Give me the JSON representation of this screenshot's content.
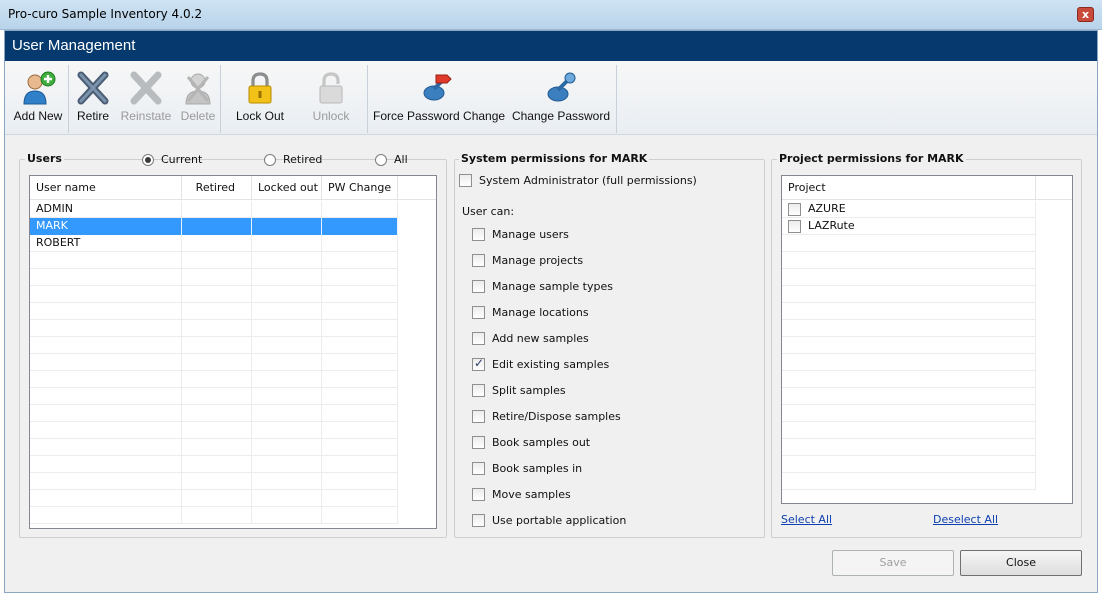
{
  "window": {
    "title": "Pro-curo Sample Inventory 4.0.2",
    "close_glyph": "x"
  },
  "header": {
    "title": "User Management"
  },
  "toolbar": {
    "add_new": "Add New",
    "retire": "Retire",
    "reinstate": "Reinstate",
    "delete": "Delete",
    "lock_out": "Lock Out",
    "unlock": "Unlock",
    "force_password_change": "Force Password Change",
    "change_password": "Change Password"
  },
  "users_panel": {
    "title": "Users",
    "filters": {
      "current": "Current",
      "retired": "Retired",
      "all": "All",
      "selected": "current"
    },
    "columns": [
      "User name",
      "Retired",
      "Locked out",
      "PW Change"
    ],
    "rows": [
      {
        "name": "ADMIN",
        "retired": "",
        "locked_out": "",
        "pw_change": ""
      },
      {
        "name": "MARK",
        "retired": "",
        "locked_out": "",
        "pw_change": ""
      },
      {
        "name": "ROBERT",
        "retired": "",
        "locked_out": "",
        "pw_change": ""
      }
    ],
    "selected_user": "MARK"
  },
  "system_permissions": {
    "title": "System permissions for MARK",
    "sysadmin": {
      "label": "System Administrator (full permissions)",
      "checked": false
    },
    "user_can_label": "User can:",
    "items": [
      {
        "label": "Manage users",
        "checked": false
      },
      {
        "label": "Manage projects",
        "checked": false
      },
      {
        "label": "Manage sample types",
        "checked": false
      },
      {
        "label": "Manage locations",
        "checked": false
      },
      {
        "label": "Add new samples",
        "checked": false
      },
      {
        "label": "Edit existing samples",
        "checked": true
      },
      {
        "label": "Split samples",
        "checked": false
      },
      {
        "label": "Retire/Dispose samples",
        "checked": false
      },
      {
        "label": "Book samples out",
        "checked": false
      },
      {
        "label": "Book samples in",
        "checked": false
      },
      {
        "label": "Move samples",
        "checked": false
      },
      {
        "label": "Use portable application",
        "checked": false
      }
    ]
  },
  "project_permissions": {
    "title": "Project permissions for MARK",
    "column": "Project",
    "projects": [
      {
        "name": "AZURE",
        "checked": false
      },
      {
        "name": "LAZRute",
        "checked": false
      }
    ],
    "select_all": "Select All",
    "deselect_all": "Deselect All"
  },
  "footer": {
    "save": "Save",
    "close": "Close"
  },
  "colors": {
    "header_bg": "#063a6e",
    "selection": "#3399ff",
    "link": "#0d3fb0"
  }
}
